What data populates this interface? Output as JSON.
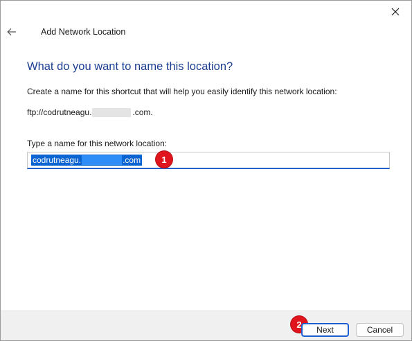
{
  "window": {
    "title": "Add Network Location",
    "close_icon": "close-icon",
    "back_icon": "back-arrow-icon"
  },
  "main": {
    "heading": "What do you want to name this location?",
    "description": "Create a name for this shortcut that will help you easily identify this network location:",
    "address_prefix": "ftp://codrutneagu.",
    "address_suffix": ".com.",
    "field_label": "Type a name for this network location:",
    "field_value_prefix": "codrutneagu.",
    "field_value_suffix": ".com"
  },
  "annotations": {
    "step1": "1",
    "step2": "2",
    "badge_color": "#e0141c"
  },
  "footer": {
    "next_label": "Next",
    "cancel_label": "Cancel"
  },
  "colors": {
    "heading": "#1c3f94",
    "selection": "#0a64d2",
    "input_underline": "#2062c9"
  }
}
